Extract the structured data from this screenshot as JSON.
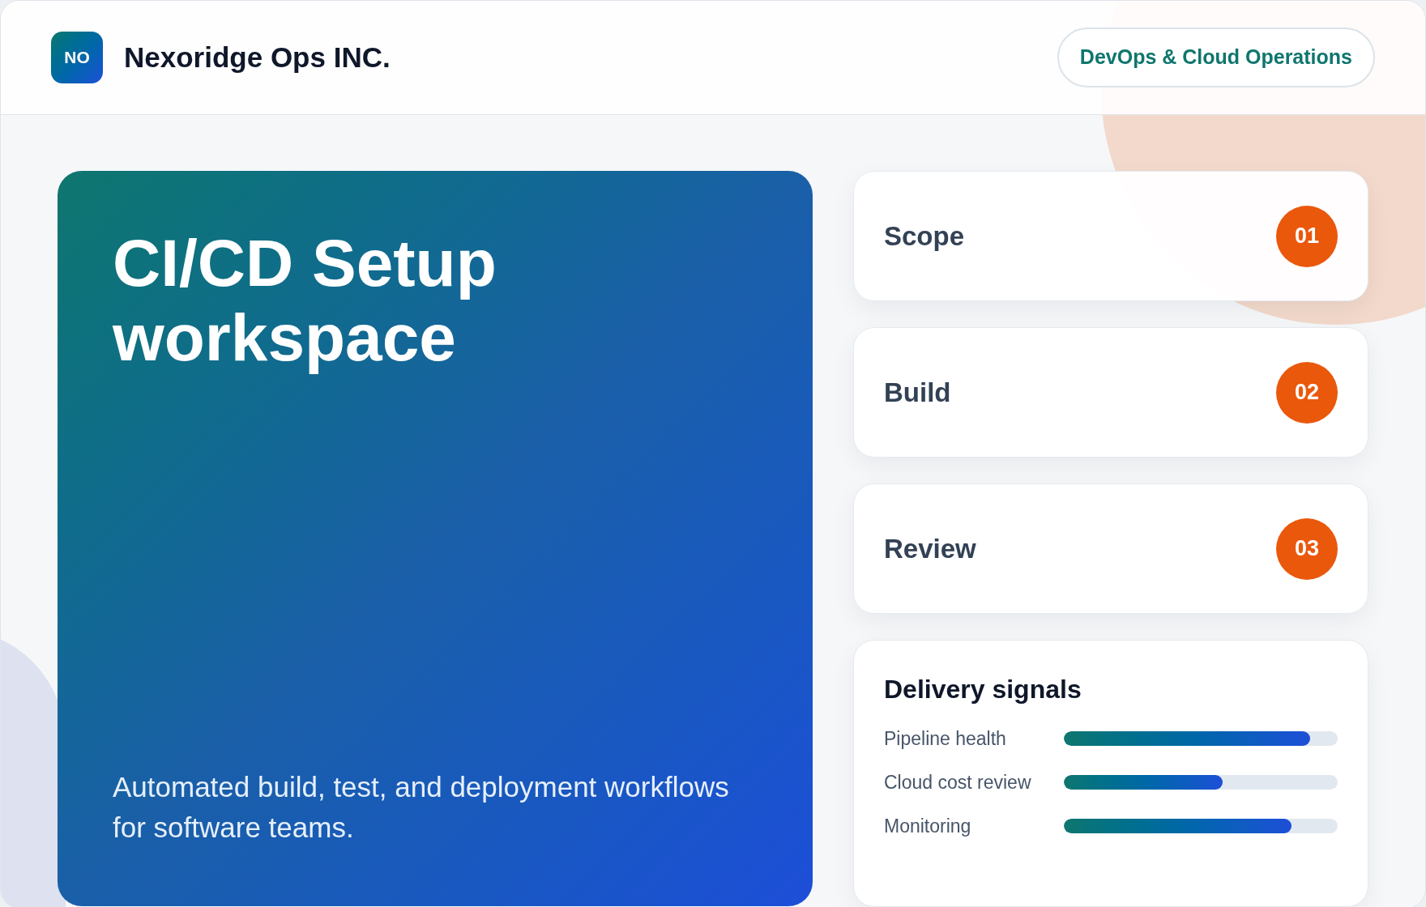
{
  "brand": {
    "logo": "NO",
    "name": "Nexoridge Ops INC."
  },
  "category_badge": "DevOps & Cloud Operations",
  "hero": {
    "title": "CI/CD Setup workspace",
    "subtitle": "Automated build, test, and deployment workflows for software teams."
  },
  "steps": [
    {
      "label": "Scope",
      "number": "01"
    },
    {
      "label": "Build",
      "number": "02"
    },
    {
      "label": "Review",
      "number": "03"
    }
  ],
  "signals": {
    "title": "Delivery signals",
    "items": [
      {
        "label": "Pipeline health",
        "level": 0.9
      },
      {
        "label": "Cloud cost review",
        "level": 0.58
      },
      {
        "label": "Monitoring",
        "level": 0.83
      }
    ]
  }
}
